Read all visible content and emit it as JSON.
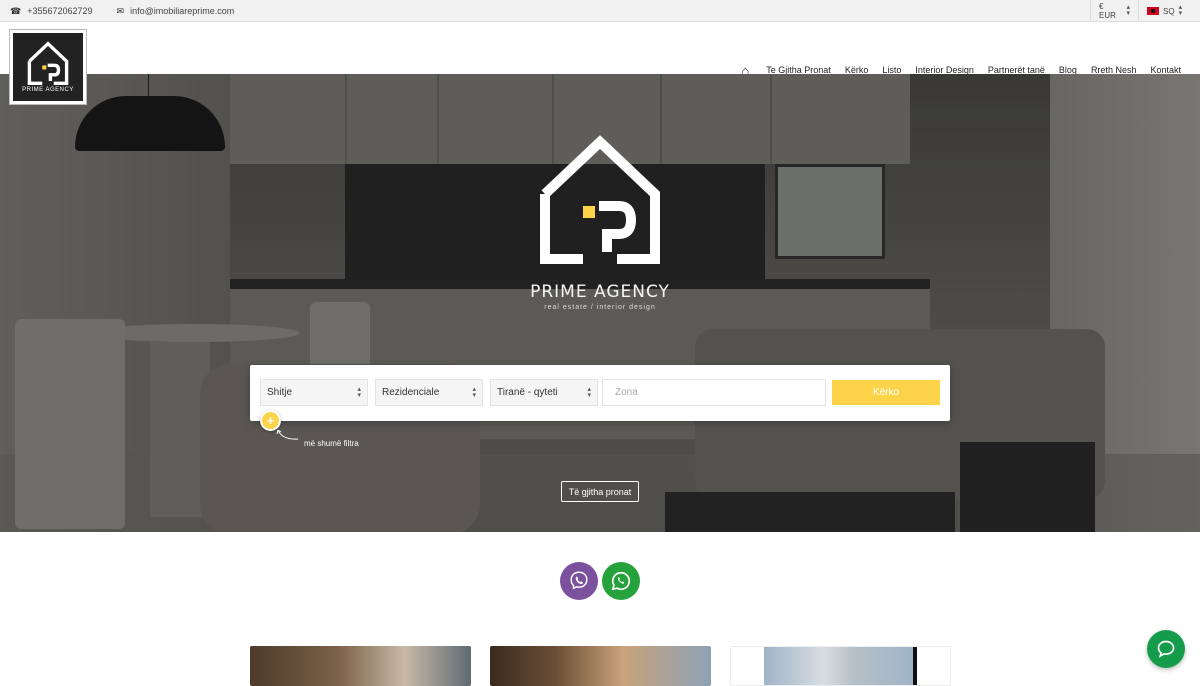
{
  "topbar": {
    "phone": "+355672062729",
    "email": "info@imobiliareprime.com",
    "currency": "€ EUR",
    "language": "SQ"
  },
  "logo": {
    "brand": "PRIME AGENCY"
  },
  "nav": {
    "items": [
      "Te Gjitha Pronat",
      "Kërko",
      "Listo",
      "Interior Design",
      "Partnerët tanë",
      "Blog",
      "Rreth Nesh",
      "Kontakt"
    ]
  },
  "hero": {
    "brand": "PRIME AGENCY",
    "tagline": "real estate / interior design"
  },
  "search": {
    "type": "Shitje",
    "category": "Rezidenciale",
    "city": "Tiranë - qyteti",
    "zone_placeholder": "Zona",
    "button": "Kërko",
    "more_filters_symbol": "+",
    "more_filters_label": "më shumë filtra"
  },
  "all_properties_button": "Të gjitha pronat",
  "colors": {
    "accent": "#fdd34a",
    "viber": "#7b519d",
    "whatsapp": "#25a23b",
    "chat": "#149c4a"
  }
}
